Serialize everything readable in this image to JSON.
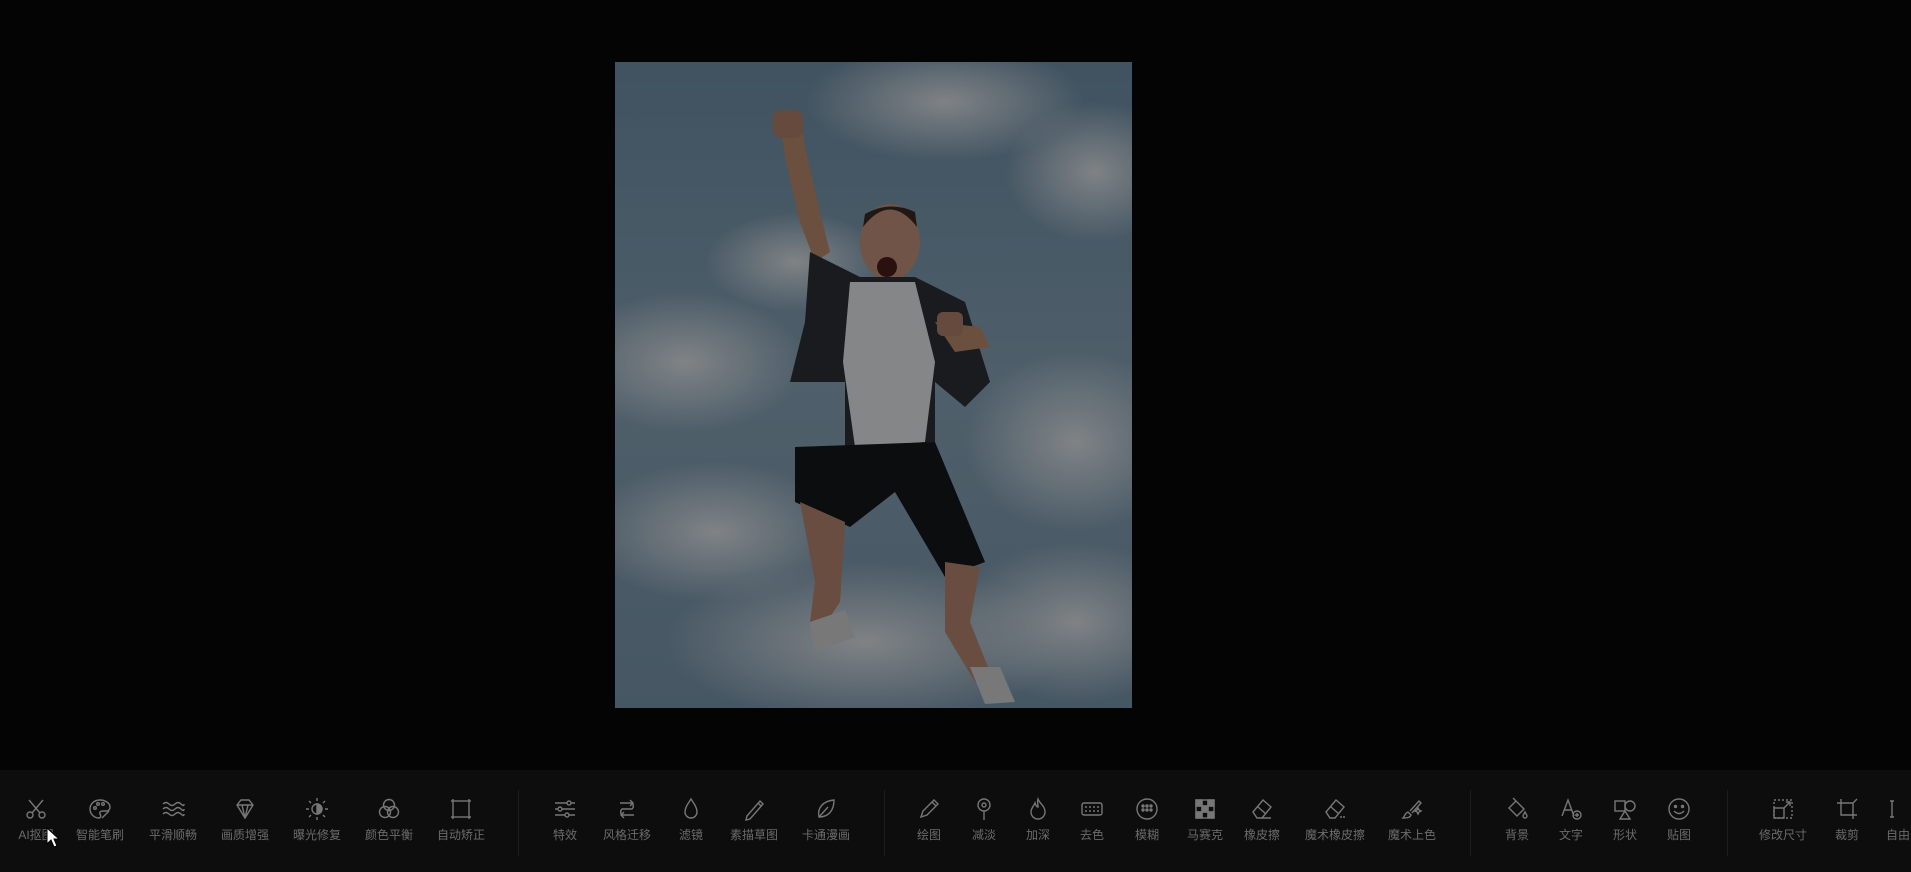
{
  "colors": {
    "background": "#040404",
    "toolbar_bg": "#0d0d0d",
    "icon": "#777777",
    "label": "#6b6b6b"
  },
  "canvas": {
    "image_description": "photo-man-jumping-against-cloudy-sky"
  },
  "toolbar": {
    "groups": [
      {
        "name": "ai-tools",
        "items": [
          {
            "label": "AI抠图",
            "icon": "scissors-icon"
          },
          {
            "label": "智能笔刷",
            "icon": "palette-icon"
          },
          {
            "label": "平滑顺畅",
            "icon": "waves-icon"
          },
          {
            "label": "画质增强",
            "icon": "diamond-icon"
          },
          {
            "label": "曝光修复",
            "icon": "brightness-icon"
          },
          {
            "label": "颜色平衡",
            "icon": "color-circles-icon"
          },
          {
            "label": "自动矫正",
            "icon": "frame-correct-icon"
          }
        ]
      },
      {
        "name": "effects",
        "items": [
          {
            "label": "特效",
            "icon": "sliders-icon"
          },
          {
            "label": "风格迁移",
            "icon": "style-transfer-icon"
          },
          {
            "label": "滤镜",
            "icon": "drop-icon"
          },
          {
            "label": "素描草图",
            "icon": "sketch-pen-icon"
          },
          {
            "label": "卡通漫画",
            "icon": "leaf-icon"
          }
        ]
      },
      {
        "name": "brushes",
        "items": [
          {
            "label": "绘图",
            "icon": "pencil-icon"
          },
          {
            "label": "减淡",
            "icon": "dodge-icon"
          },
          {
            "label": "加深",
            "icon": "flame-icon"
          },
          {
            "label": "去色",
            "icon": "desaturate-icon"
          },
          {
            "label": "模糊",
            "icon": "blur-icon"
          },
          {
            "label": "马赛克",
            "icon": "mosaic-icon"
          },
          {
            "label": "橡皮擦",
            "icon": "eraser-icon"
          },
          {
            "label": "魔术橡皮擦",
            "icon": "magic-eraser-icon"
          },
          {
            "label": "魔术上色",
            "icon": "magic-brush-icon"
          }
        ]
      },
      {
        "name": "insert",
        "items": [
          {
            "label": "背景",
            "icon": "paint-bucket-icon"
          },
          {
            "label": "文字",
            "icon": "text-add-icon"
          },
          {
            "label": "形状",
            "icon": "shapes-icon"
          },
          {
            "label": "贴图",
            "icon": "smiley-icon"
          }
        ]
      },
      {
        "name": "transform",
        "items": [
          {
            "label": "修改尺寸",
            "icon": "resize-icon"
          },
          {
            "label": "裁剪",
            "icon": "crop-icon"
          },
          {
            "label": "自由",
            "icon": "free-transform-icon"
          }
        ]
      }
    ]
  }
}
